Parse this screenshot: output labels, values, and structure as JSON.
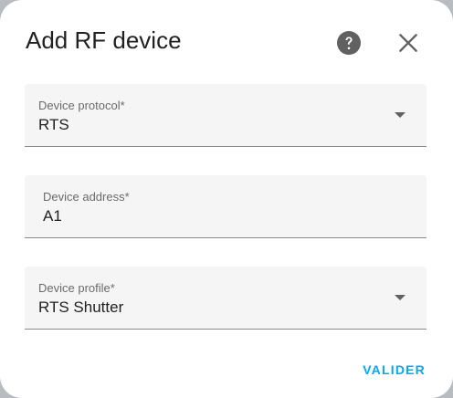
{
  "dialog": {
    "title": "Add RF device",
    "help_icon": "help-circle-icon",
    "close_icon": "close-icon"
  },
  "fields": {
    "protocol": {
      "label": "Device protocol*",
      "value": "RTS"
    },
    "address": {
      "label": "Device address*",
      "value": "A1"
    },
    "profile": {
      "label": "Device profile*",
      "value": "RTS Shutter"
    }
  },
  "actions": {
    "submit_label": "VALIDER"
  },
  "colors": {
    "accent": "#03a9f4",
    "field_background": "#f5f5f5",
    "icon_dark": "#616161"
  }
}
